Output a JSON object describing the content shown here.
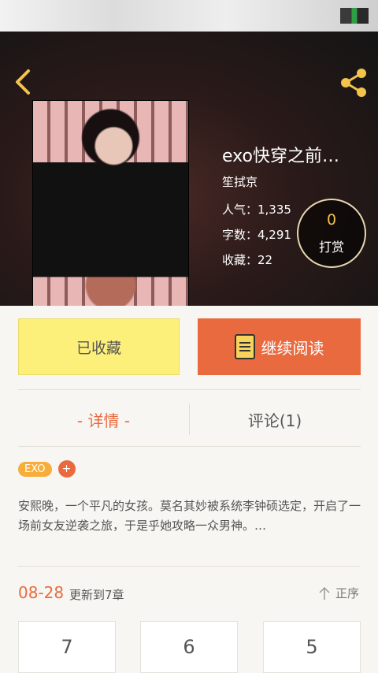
{
  "header": {
    "back_icon": "chevron-left-icon",
    "share_icon": "share-icon",
    "accent_color": "#f3c34c"
  },
  "book": {
    "title": "exo快穿之前…",
    "author": "笙拭京",
    "popularity": "人气：1,335",
    "words": "字数：4,291",
    "favorites": "收藏：22",
    "tip_count": "0",
    "tip_label": "打赏"
  },
  "actions": {
    "favorite_label": "已收藏",
    "read_label": "继续阅读",
    "read_icon": "book-icon",
    "favorite_color": "#fdf07a",
    "read_color": "#ea6a3f"
  },
  "tabs": [
    {
      "label": "- 详情 -",
      "active": true
    },
    {
      "label": "评论(1)",
      "active": false
    }
  ],
  "tags": [
    "EXO"
  ],
  "tag_add_label": "+",
  "synopsis": "安熙晚，一个平凡的女孩。莫名其妙被系统李钟硕选定，开启了一场前女友逆袭之旅，于是乎她攻略一众男神。…",
  "update": {
    "date": "08-28",
    "text": "更新到7章",
    "sort_label": "正序",
    "sort_icon": "arrow-up-icon"
  },
  "chapters": [
    "7",
    "6",
    "5"
  ]
}
